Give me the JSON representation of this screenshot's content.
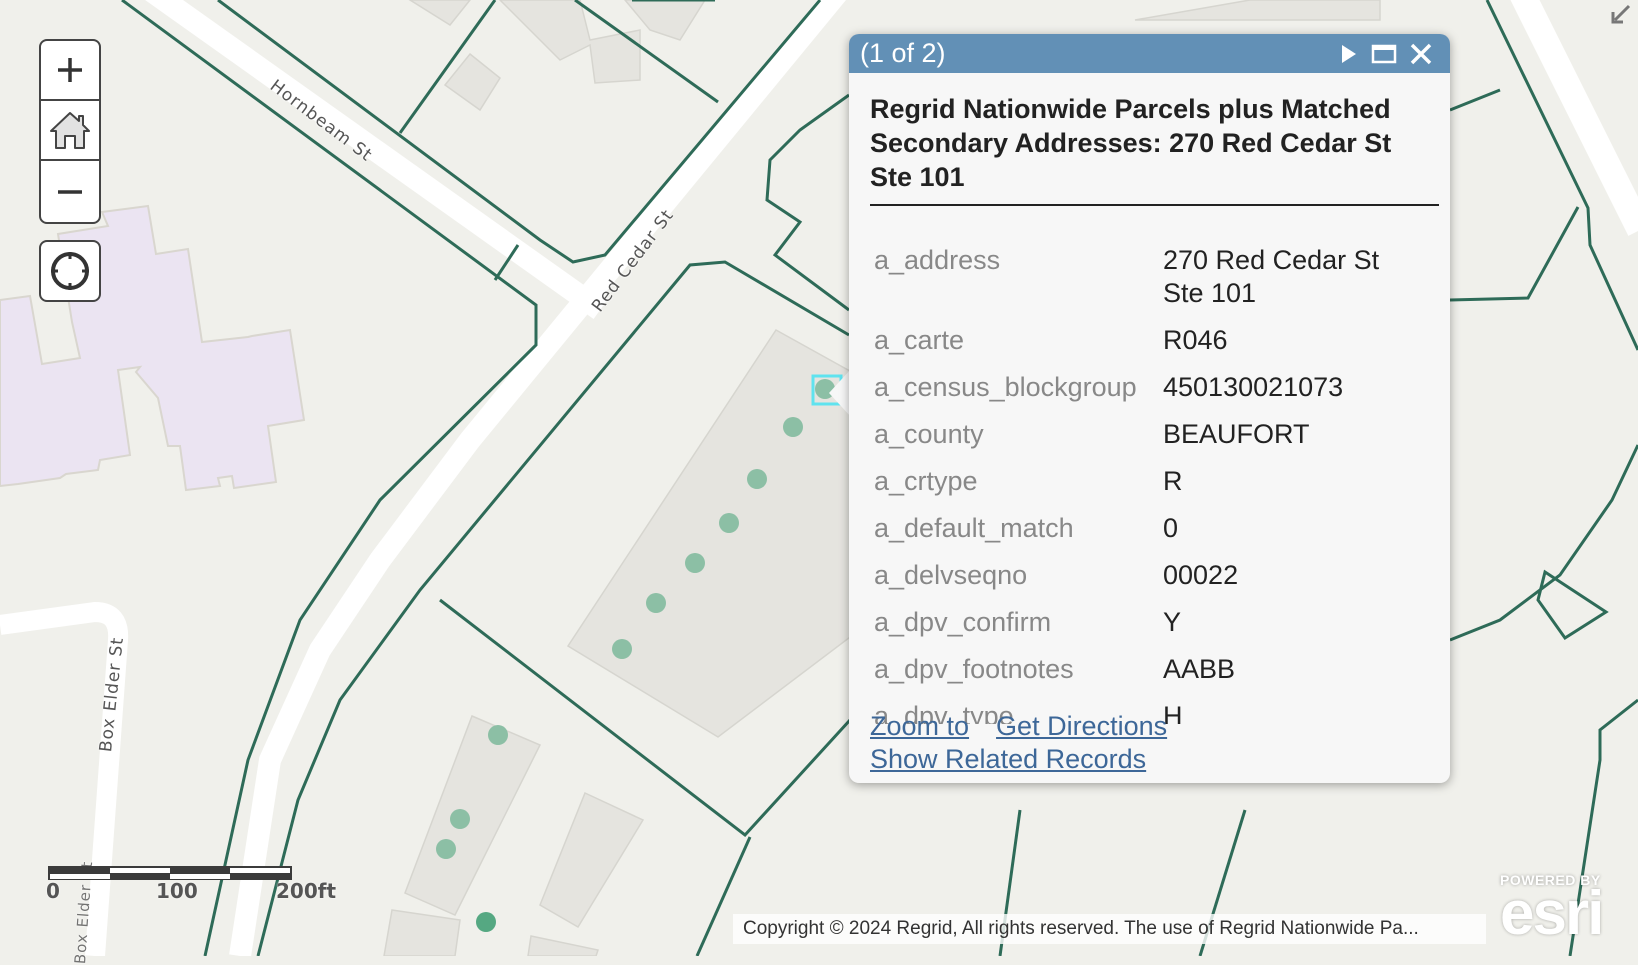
{
  "map": {
    "streets": [
      {
        "name": "Hornbeam St"
      },
      {
        "name": "Red Cedar St"
      },
      {
        "name": "Box Elder St"
      },
      {
        "name": "Box Elder St"
      }
    ],
    "colors": {
      "background": "#f0f0eb",
      "parcel_line": "#2e6b58",
      "road": "#ffffff",
      "building": "#e5e4df",
      "school_building": "#ebe4f2",
      "address_point": "#8cbfa5",
      "address_point_dark": "#55a882",
      "selection": "#5fe3ef"
    }
  },
  "controls": {
    "zoom_in": {
      "icon": "plus-icon",
      "label": "+"
    },
    "home": {
      "icon": "home-icon"
    },
    "zoom_out": {
      "icon": "minus-icon",
      "label": "−"
    },
    "locate": {
      "icon": "locate-icon"
    },
    "expand": {
      "icon": "expand-icon"
    }
  },
  "scalebar": {
    "labels": [
      "0",
      "100",
      "200ft"
    ]
  },
  "popup": {
    "header": {
      "counter": "(1 of 2)",
      "next_icon": "next-arrow-icon",
      "maximize_icon": "maximize-icon",
      "close_icon": "close-icon",
      "color": "#6290b6"
    },
    "title": "Regrid Nationwide Parcels plus Matched Secondary Addresses: 270 Red Cedar St Ste 101",
    "fields": [
      {
        "key": "a_address",
        "value": "270 Red Cedar St Ste 101"
      },
      {
        "key": "a_carte",
        "value": "R046"
      },
      {
        "key": "a_census_blockgroup",
        "value": "450130021073"
      },
      {
        "key": "a_county",
        "value": "BEAUFORT"
      },
      {
        "key": "a_crtype",
        "value": "R"
      },
      {
        "key": "a_default_match",
        "value": "0"
      },
      {
        "key": "a_delvseqno",
        "value": "00022"
      },
      {
        "key": "a_dpv_confirm",
        "value": "Y"
      },
      {
        "key": "a_dpv_footnotes",
        "value": "AABB"
      },
      {
        "key": "a_dpv_type",
        "value": "H"
      }
    ],
    "actions": {
      "zoom_to": "Zoom to",
      "get_directions": "Get Directions",
      "show_related": "Show Related Records"
    }
  },
  "attribution": "Copyright © 2024 Regrid, All rights reserved. The use of Regrid Nationwide Pa...",
  "esri": {
    "powered_by": "POWERED BY",
    "logo": "esri"
  }
}
